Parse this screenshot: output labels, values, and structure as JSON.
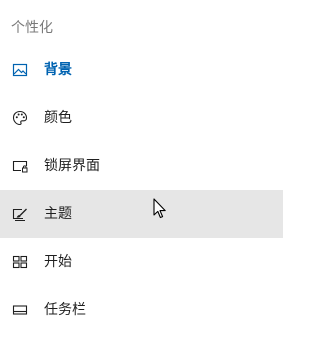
{
  "section": {
    "title": "个性化"
  },
  "nav": {
    "items": [
      {
        "label": "背景",
        "icon": "image-icon",
        "state": "selected"
      },
      {
        "label": "颜色",
        "icon": "palette-icon",
        "state": "normal"
      },
      {
        "label": "锁屏界面",
        "icon": "lock-screen-icon",
        "state": "normal"
      },
      {
        "label": "主题",
        "icon": "theme-icon",
        "state": "hover"
      },
      {
        "label": "开始",
        "icon": "start-icon",
        "state": "normal"
      },
      {
        "label": "任务栏",
        "icon": "taskbar-icon",
        "state": "normal"
      }
    ]
  },
  "colors": {
    "accent": "#0063b1",
    "text": "#1f1f1f",
    "muted": "#7a7a7a",
    "hover_bg": "#e6e6e6"
  }
}
